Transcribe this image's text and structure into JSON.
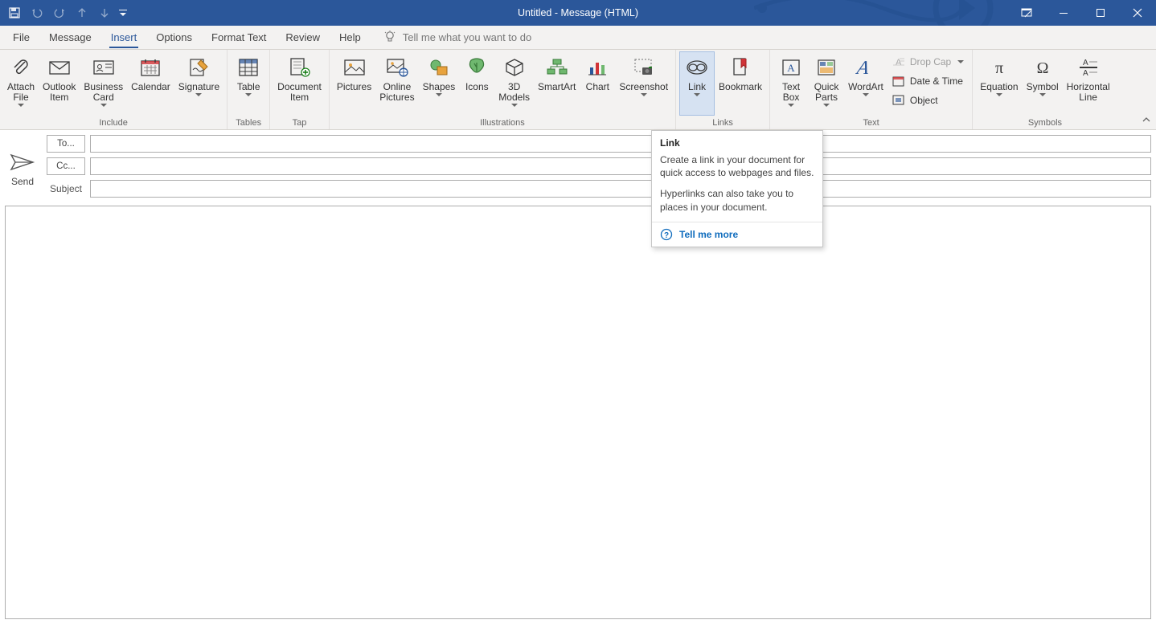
{
  "title": "Untitled  -  Message (HTML)",
  "qat": {
    "save": "save",
    "undo": "undo",
    "redo": "redo",
    "prev": "prev",
    "next": "next",
    "more": "more"
  },
  "tabs": {
    "file": "File",
    "message": "Message",
    "insert": "Insert",
    "options": "Options",
    "formatText": "Format Text",
    "review": "Review",
    "help": "Help",
    "tellme": "Tell me what you want to do"
  },
  "ribbon": {
    "groups": {
      "include": {
        "label": "Include",
        "attachFile": "Attach\nFile",
        "outlookItem": "Outlook\nItem",
        "businessCard": "Business\nCard",
        "calendar": "Calendar",
        "signature": "Signature"
      },
      "tables": {
        "label": "Tables",
        "table": "Table"
      },
      "tap": {
        "label": "Tap",
        "documentItem": "Document\nItem"
      },
      "illustrations": {
        "label": "Illustrations",
        "pictures": "Pictures",
        "onlinePictures": "Online\nPictures",
        "shapes": "Shapes",
        "icons": "Icons",
        "models3d": "3D\nModels",
        "smartArt": "SmartArt",
        "chart": "Chart",
        "screenshot": "Screenshot"
      },
      "links": {
        "label": "Links",
        "link": "Link",
        "bookmark": "Bookmark"
      },
      "text": {
        "label": "Text",
        "textBox": "Text\nBox",
        "quickParts": "Quick\nParts",
        "wordArt": "WordArt",
        "dropCap": "Drop Cap",
        "dateTime": "Date & Time",
        "object": "Object"
      },
      "symbols": {
        "label": "Symbols",
        "equation": "Equation",
        "symbol": "Symbol",
        "horizontalLine": "Horizontal\nLine"
      }
    }
  },
  "compose": {
    "send": "Send",
    "to": "To...",
    "cc": "Cc...",
    "subject": "Subject"
  },
  "tooltip": {
    "title": "Link",
    "desc1": "Create a link in your document for quick access to webpages and files.",
    "desc2": "Hyperlinks can also take you to places in your document.",
    "more": "Tell me more"
  }
}
